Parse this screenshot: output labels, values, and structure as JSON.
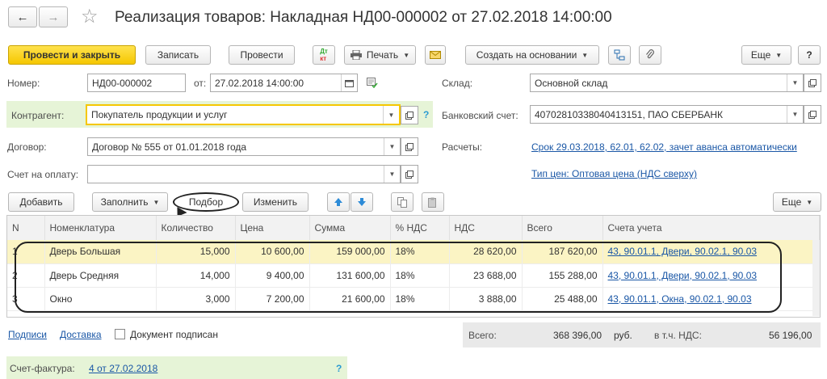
{
  "title": "Реализация товаров: Накладная НД00-000002 от 27.02.2018 14:00:00",
  "nav": {
    "back": "←",
    "forward": "→",
    "star": "☆"
  },
  "toolbar": {
    "post_close": "Провести и закрыть",
    "save": "Записать",
    "post": "Провести",
    "dtkt_top": "Дт",
    "dtkt_bottom": "кт",
    "print": "Печать",
    "create_based": "Создать на основании",
    "more": "Еще",
    "help": "?"
  },
  "form": {
    "number_label": "Номер:",
    "number_value": "НД00-000002",
    "date_label": "от:",
    "date_value": "27.02.2018 14:00:00",
    "counterparty_label": "Контрагент:",
    "counterparty_value": "Покупатель продукции и услуг",
    "contract_label": "Договор:",
    "contract_value": "Договор № 555 от 01.01.2018 года",
    "invoice_label": "Счет на оплату:",
    "invoice_value": "",
    "warehouse_label": "Склад:",
    "warehouse_value": "Основной склад",
    "bank_label": "Банковский счет:",
    "bank_value": "40702810338040413151, ПАО СБЕРБАНК",
    "settlements_label": "Расчеты:",
    "settlements_link": "Срок 29.03.2018, 62.01, 62.02, зачет аванса автоматически",
    "price_type_link": "Тип цен: Оптовая цена (НДС сверху)",
    "help_mark": "?"
  },
  "table_toolbar": {
    "add": "Добавить",
    "fill": "Заполнить",
    "pick": "Подбор",
    "change": "Изменить",
    "more": "Еще"
  },
  "table": {
    "headers": [
      "N",
      "Номенклатура",
      "Количество",
      "Цена",
      "Сумма",
      "% НДС",
      "НДС",
      "Всего",
      "Счета учета"
    ],
    "rows": [
      {
        "n": "1",
        "name": "Дверь Большая",
        "qty": "15,000",
        "price": "10 600,00",
        "sum": "159 000,00",
        "vat_rate": "18%",
        "vat": "28 620,00",
        "total": "187 620,00",
        "accounts": "43, 90.01.1, Двери, 90.02.1, 90.03"
      },
      {
        "n": "2",
        "name": "Дверь Средняя",
        "qty": "14,000",
        "price": "9 400,00",
        "sum": "131 600,00",
        "vat_rate": "18%",
        "vat": "23 688,00",
        "total": "155 288,00",
        "accounts": "43, 90.01.1, Двери, 90.02.1, 90.03"
      },
      {
        "n": "3",
        "name": "Окно",
        "qty": "3,000",
        "price": "7 200,00",
        "sum": "21 600,00",
        "vat_rate": "18%",
        "vat": "3 888,00",
        "total": "25 488,00",
        "accounts": "43, 90.01.1, Окна, 90.02.1, 90.03"
      }
    ]
  },
  "footer": {
    "signatures_link": "Подписи",
    "delivery_link": "Доставка",
    "signed_label": "Документ подписан",
    "total_label": "Всего:",
    "total_value": "368 396,00",
    "currency": "руб.",
    "vat_label": "в т.ч. НДС:",
    "vat_value": "56 196,00",
    "invoice_label": "Счет-фактура:",
    "invoice_link": "4 от 27.02.2018",
    "help_mark": "?"
  },
  "colors": {
    "primary_button": "#f5c700",
    "link": "#1a57a6",
    "highlight_row": "#fbf4c4",
    "counterparty_bg": "#e6f4d7"
  }
}
